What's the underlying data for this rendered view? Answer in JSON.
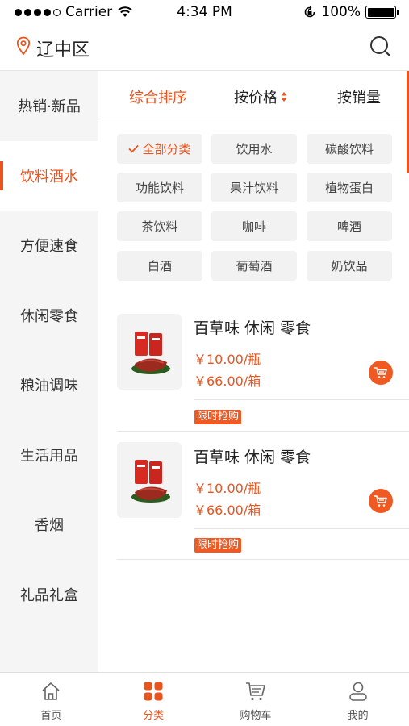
{
  "status_bar": {
    "carrier": "Carrier",
    "time": "4:34 PM",
    "battery": "100%"
  },
  "header": {
    "location": "辽中区"
  },
  "sidebar": {
    "items": [
      {
        "label": "热销·新品"
      },
      {
        "label": "饮料酒水"
      },
      {
        "label": "方便速食"
      },
      {
        "label": "休闲零食"
      },
      {
        "label": "粮油调味"
      },
      {
        "label": "生活用品"
      },
      {
        "label": "香烟"
      },
      {
        "label": "礼品礼盒"
      }
    ],
    "active_index": 1
  },
  "sort_tabs": [
    {
      "label": "综合排序"
    },
    {
      "label": "按价格"
    },
    {
      "label": "按销量"
    }
  ],
  "categories": [
    {
      "label": "全部分类"
    },
    {
      "label": "饮用水"
    },
    {
      "label": "碳酸饮料"
    },
    {
      "label": "功能饮料"
    },
    {
      "label": "果汁饮料"
    },
    {
      "label": "植物蛋白"
    },
    {
      "label": "茶饮料"
    },
    {
      "label": "咖啡"
    },
    {
      "label": "啤酒"
    },
    {
      "label": "白酒"
    },
    {
      "label": "葡萄酒"
    },
    {
      "label": "奶饮品"
    }
  ],
  "products": [
    {
      "title": "百草味 休闲 零食",
      "price_unit": "￥10.00/瓶",
      "price_box": "￥66.00/箱",
      "tag": "限时抢购"
    },
    {
      "title": "百草味 休闲 零食",
      "price_unit": "￥10.00/瓶",
      "price_box": "￥66.00/箱",
      "tag": "限时抢购"
    }
  ],
  "tabbar": [
    {
      "label": "首页",
      "icon": "home-icon"
    },
    {
      "label": "分类",
      "icon": "category-icon"
    },
    {
      "label": "购物车",
      "icon": "cart-icon"
    },
    {
      "label": "我的",
      "icon": "user-icon"
    }
  ],
  "colors": {
    "accent": "#e8541e",
    "sidebar_bg": "#f5f5f5",
    "chip_bg": "#f2f2f2"
  }
}
